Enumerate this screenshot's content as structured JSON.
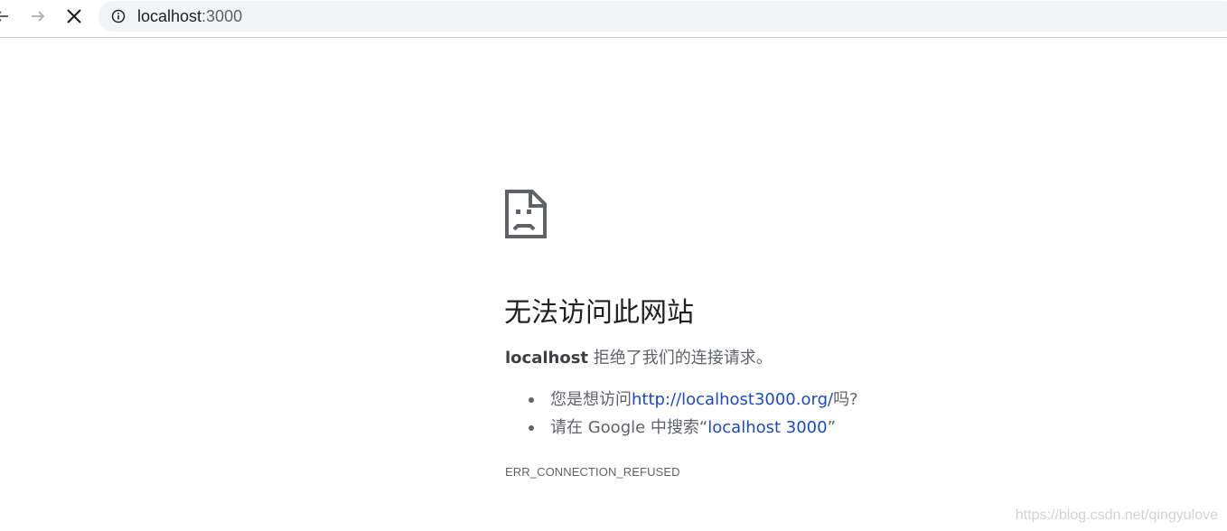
{
  "toolbar": {
    "back_icon": "arrow-left-icon",
    "forward_icon": "arrow-right-icon",
    "stop_icon": "close-icon",
    "site_info_icon": "info-circle-icon",
    "address": {
      "host": "localhost",
      "port": ":3000"
    }
  },
  "error": {
    "icon": "sad-page-icon",
    "title": "无法访问此网站",
    "summary_host": "localhost",
    "summary_text": " 拒绝了我们的连接请求。",
    "suggestions": [
      {
        "prefix": "您是想访问",
        "link": "http://localhost3000.org/",
        "suffix": "吗?"
      },
      {
        "prefix": "请在 Google 中搜索“",
        "link": "localhost 3000",
        "suffix": "”"
      }
    ],
    "code": "ERR_CONNECTION_REFUSED"
  },
  "watermark": "https://blog.csdn.net/qingyulove",
  "colors": {
    "omnibox_bg": "#f1f3f4",
    "title": "#202124",
    "body_text": "#5f6368",
    "link": "#1a4ac7",
    "icon": "#5f6368"
  }
}
